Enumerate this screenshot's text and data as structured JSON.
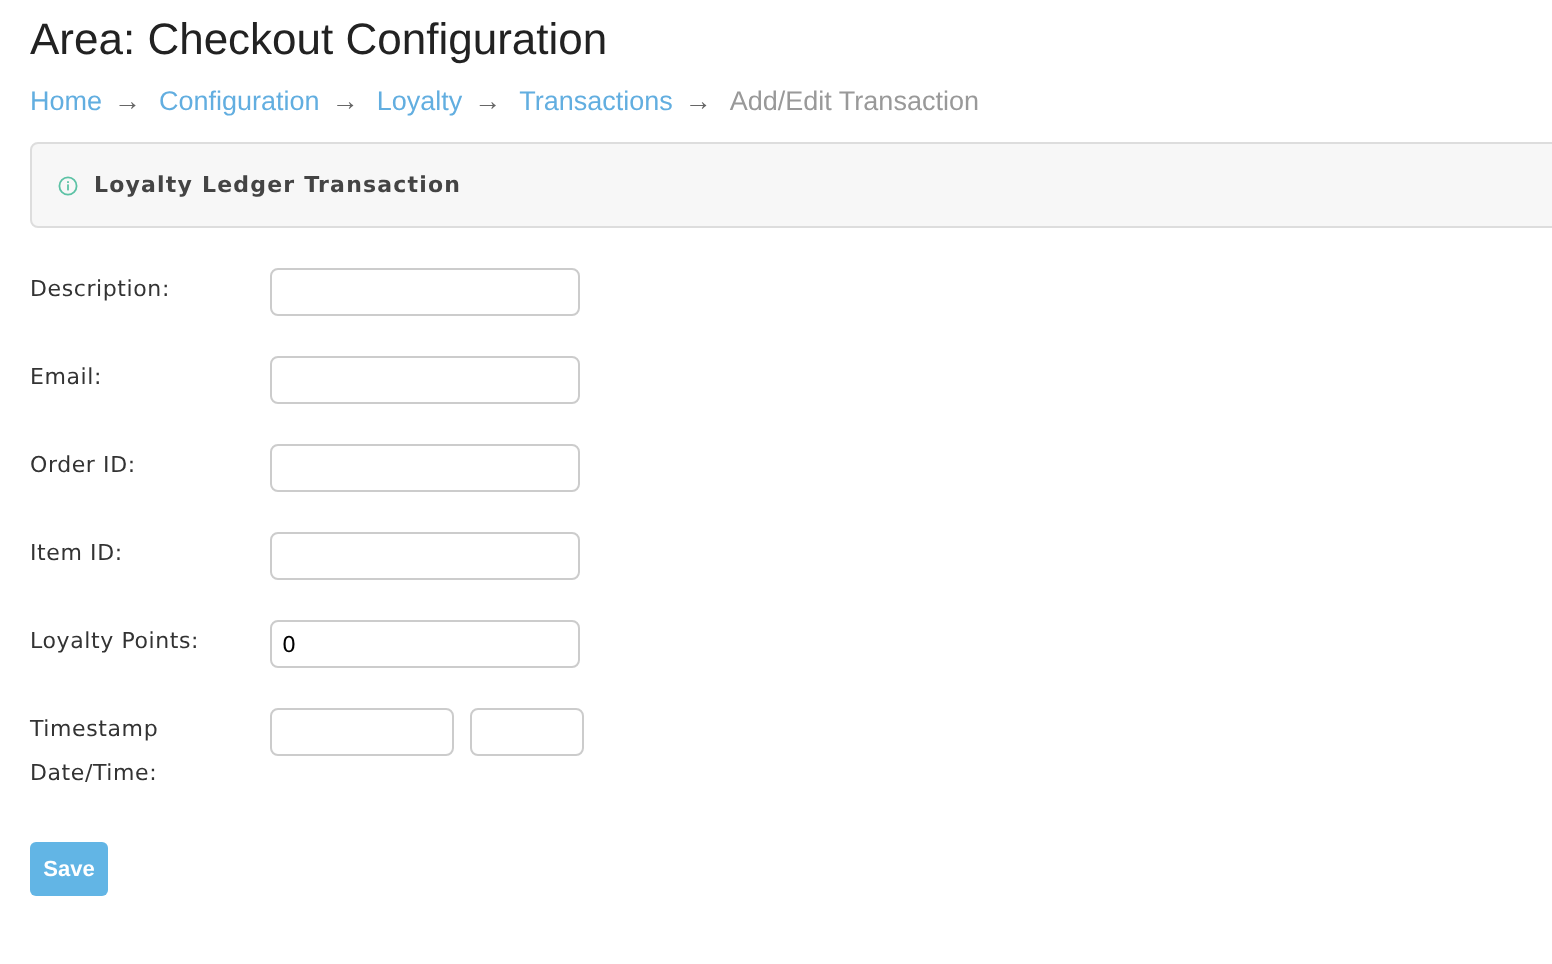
{
  "title": "Area: Checkout Configuration",
  "breadcrumb": [
    {
      "label": "Home",
      "kind": "link",
      "arrow": "→"
    },
    {
      "label": "Configuration",
      "kind": "link",
      "arrow": "→"
    },
    {
      "label": "Loyalty",
      "kind": "link",
      "arrow": "→"
    },
    {
      "label": "Transactions",
      "kind": "link",
      "arrow": "→"
    },
    {
      "label": "Add/Edit Transaction",
      "kind": "current"
    }
  ],
  "panel": {
    "title": "Loyalty Ledger Transaction"
  },
  "fields": [
    {
      "label": "Description:",
      "kind": "text"
    },
    {
      "label": "Email:",
      "kind": "text"
    },
    {
      "label": "Order ID:",
      "kind": "text"
    },
    {
      "label": "Item ID:",
      "kind": "text"
    },
    {
      "label": "Loyalty Points:",
      "kind": "text",
      "value": "0"
    },
    {
      "label": "Timestamp Date/Time:",
      "kind": "datetime"
    }
  ],
  "save_button": "Save"
}
